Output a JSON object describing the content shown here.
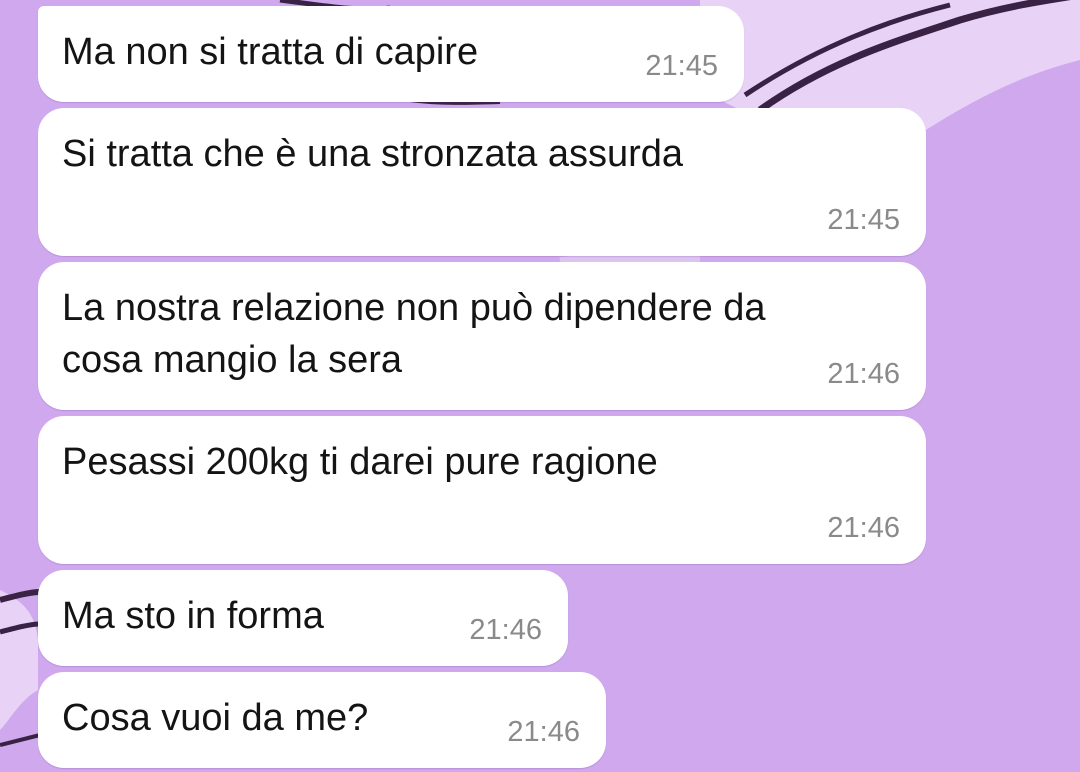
{
  "theme": {
    "bubble_color": "#ffffff",
    "text_color": "#141414",
    "time_color": "#8a8a8a",
    "wallpaper_color": "#cfa8ee",
    "wallpaper_light": "#e8d3f7"
  },
  "messages": [
    {
      "text": "Ma non si tratta di capire",
      "time": "21:45"
    },
    {
      "text": "Si tratta che è una stronzata assurda",
      "time": "21:45"
    },
    {
      "text": "La nostra relazione non può dipendere da\ncosa mangio la sera",
      "time": "21:46"
    },
    {
      "text": "Pesassi 200kg ti darei pure ragione",
      "time": "21:46"
    },
    {
      "text": "Ma sto in forma",
      "time": "21:46"
    },
    {
      "text": "Cosa vuoi da me?",
      "time": "21:46"
    }
  ]
}
